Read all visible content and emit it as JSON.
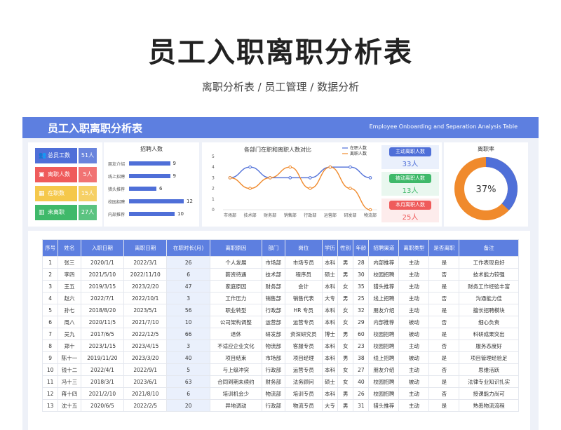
{
  "header": {
    "title": "员工入职离职分析表",
    "subtitle": "离职分析表 / 员工管理 / 数据分析"
  },
  "banner": {
    "title_cn": "员工入职离职分析表",
    "title_en": "Employee Onboarding and Separation Analysis Table"
  },
  "stats": [
    {
      "label": "总员工数",
      "value": "51人",
      "color": "#4f6fd8",
      "icon": "people-icon"
    },
    {
      "label": "离职人数",
      "value": "5人",
      "color": "#ef5b5b",
      "icon": "briefcase-icon"
    },
    {
      "label": "在职数",
      "value": "15人",
      "color": "#f5c84b",
      "icon": "calendar-icon"
    },
    {
      "label": "未离职",
      "value": "27人",
      "color": "#3fb96a",
      "icon": "bar-chart-icon"
    }
  ],
  "recruit": {
    "title": "招聘人数",
    "items": [
      {
        "label": "朋友介绍",
        "value": 9
      },
      {
        "label": "线上招聘",
        "value": 9
      },
      {
        "label": "猎头推荐",
        "value": 6
      },
      {
        "label": "校园招聘",
        "value": 12
      },
      {
        "label": "内部推荐",
        "value": 10
      }
    ]
  },
  "chart_data": {
    "type": "line",
    "title": "各部门在职和离职人数对比",
    "categories": [
      "市场部",
      "技术部",
      "财务部",
      "销售部",
      "行政部",
      "运营部",
      "研发部",
      "物流部"
    ],
    "series": [
      {
        "name": "在职人数",
        "color": "#4f6fd8",
        "values": [
          3,
          4,
          3,
          3,
          3,
          4,
          4,
          3
        ]
      },
      {
        "name": "离职人数",
        "color": "#f08a2c",
        "values": [
          3,
          2,
          3,
          4,
          2,
          4,
          2,
          0
        ]
      }
    ],
    "ylim": [
      0,
      5
    ],
    "yticks": [
      "0",
      "1",
      "2",
      "3",
      "4",
      "5"
    ]
  },
  "pills": [
    {
      "label": "主动离职人数",
      "value": "33人",
      "bg": "#eaf0fc",
      "pill": "#4f6fd8",
      "text": "#4f6fd8"
    },
    {
      "label": "被动离职人数",
      "value": "13人",
      "bg": "#e9f7ef",
      "pill": "#3fb96a",
      "text": "#3fb96a"
    },
    {
      "label": "本月离职人数",
      "value": "25人",
      "bg": "#fdecec",
      "pill": "#ef5b5b",
      "text": "#ef5b5b"
    }
  ],
  "rate": {
    "title": "离职率",
    "value": "37%",
    "fraction": 0.37,
    "color_main": "#f08a2c",
    "color_rest": "#4f6fd8"
  },
  "table": {
    "headers": [
      "序号",
      "姓名",
      "入职日期",
      "离职日期",
      "在职时长(月)",
      "离职原因",
      "部门",
      "岗位",
      "学历",
      "性别",
      "年龄",
      "招聘渠道",
      "离职类型",
      "是否离职",
      "备注"
    ],
    "rows": [
      [
        "1",
        "张三",
        "2020/1/1",
        "2022/3/1",
        "26",
        "个人发展",
        "市场部",
        "市场专员",
        "本科",
        "男",
        "28",
        "内部推荐",
        "主动",
        "是",
        "工作表现良好"
      ],
      [
        "2",
        "李四",
        "2021/5/10",
        "2022/11/10",
        "6",
        "薪资待遇",
        "技术部",
        "程序员",
        "硕士",
        "男",
        "30",
        "校园招聘",
        "主动",
        "否",
        "技术能力较强"
      ],
      [
        "3",
        "王五",
        "2019/3/15",
        "2023/2/20",
        "47",
        "家庭原因",
        "财务部",
        "会计",
        "本科",
        "女",
        "35",
        "猎头推荐",
        "主动",
        "是",
        "财务工作经验丰富"
      ],
      [
        "4",
        "赵六",
        "2022/7/1",
        "2022/10/1",
        "3",
        "工作压力",
        "销售部",
        "销售代表",
        "大专",
        "男",
        "25",
        "线上招聘",
        "主动",
        "否",
        "沟通能力佳"
      ],
      [
        "5",
        "孙七",
        "2018/8/20",
        "2023/5/1",
        "56",
        "职业转型",
        "行政部",
        "HR 专员",
        "本科",
        "女",
        "32",
        "朋友介绍",
        "主动",
        "是",
        "擅长招聘模块"
      ],
      [
        "6",
        "周八",
        "2020/11/5",
        "2021/7/10",
        "10",
        "公司架构调整",
        "运营部",
        "运营专员",
        "本科",
        "女",
        "29",
        "内部推荐",
        "被动",
        "否",
        "细心负责"
      ],
      [
        "7",
        "吴九",
        "2017/6/5",
        "2022/12/5",
        "66",
        "退休",
        "研发部",
        "资深研究员",
        "博士",
        "男",
        "60",
        "校园招聘",
        "被动",
        "是",
        "科研成果突出"
      ],
      [
        "8",
        "郑十",
        "2023/1/15",
        "2023/4/15",
        "3",
        "不适应企业文化",
        "物流部",
        "客服专员",
        "本科",
        "女",
        "23",
        "校园招聘",
        "主动",
        "否",
        "服务态度好"
      ],
      [
        "9",
        "陈十一",
        "2019/11/20",
        "2023/3/20",
        "40",
        "项目结束",
        "市场部",
        "项目经理",
        "本科",
        "男",
        "38",
        "线上招聘",
        "被动",
        "是",
        "项目管理经验足"
      ],
      [
        "10",
        "钱十二",
        "2022/4/1",
        "2022/9/1",
        "5",
        "与上级冲突",
        "行政部",
        "运营专员",
        "本科",
        "女",
        "27",
        "朋友介绍",
        "主动",
        "否",
        "思维活跃"
      ],
      [
        "11",
        "冯十三",
        "2018/3/1",
        "2023/6/1",
        "63",
        "合同到期未续约",
        "财务部",
        "法务顾问",
        "硕士",
        "女",
        "40",
        "校园招聘",
        "被动",
        "是",
        "法律专业知识扎实"
      ],
      [
        "12",
        "蒋十四",
        "2021/2/10",
        "2021/8/10",
        "6",
        "培训机会少",
        "物流部",
        "培训专员",
        "本科",
        "男",
        "26",
        "校园招聘",
        "主动",
        "否",
        "授课能力尚可"
      ],
      [
        "13",
        "沈十五",
        "2020/6/5",
        "2022/2/5",
        "20",
        "异地调动",
        "行政部",
        "物流专员",
        "大专",
        "男",
        "31",
        "猎头推荐",
        "主动",
        "是",
        "熟悉物流流程"
      ]
    ]
  }
}
